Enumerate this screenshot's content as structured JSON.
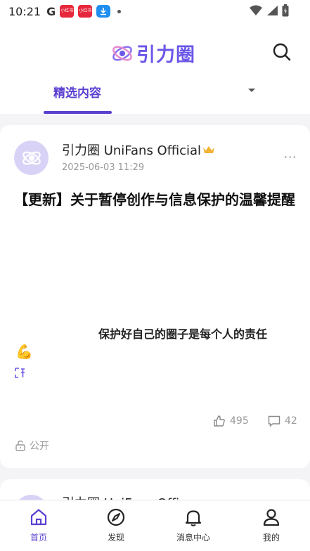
{
  "status_bar": {
    "time": "10:21",
    "g_label": "G",
    "app_badge_1": "小红书",
    "app_badge_2": "小红书"
  },
  "header": {
    "logo_text": "引力圈",
    "tab_active": "精选内容"
  },
  "post": {
    "author": "引力圈 UniFans Official",
    "time": "2025-06-03 11:29",
    "more": "···",
    "title": "【更新】关于暂停创作与信息保护的温馨提醒",
    "body": "保护好自己的圈子是每个人的责任",
    "emoji": "💪",
    "likes": "495",
    "comments": "42",
    "visibility": "公开"
  },
  "next_post": {
    "author": "引力圈 UniFans Offi"
  },
  "bottom_nav": {
    "items": [
      {
        "label": "首页"
      },
      {
        "label": "发现"
      },
      {
        "label": "消息中心"
      },
      {
        "label": "我的"
      }
    ]
  },
  "colors": {
    "accent": "#5b3fd0",
    "logo": "#6b57e8",
    "avatar_bg": "#d8d3f6"
  }
}
